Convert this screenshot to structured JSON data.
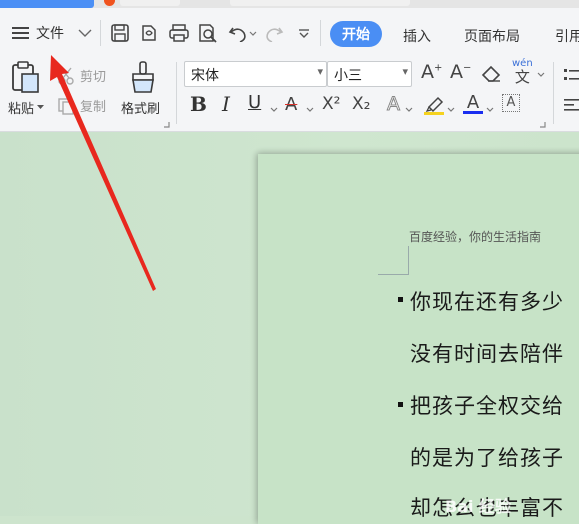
{
  "menu": {
    "file_label": "文件",
    "tabs": [
      "开始",
      "插入",
      "页面布局",
      "引用"
    ]
  },
  "clipboard": {
    "paste_label": "粘贴",
    "cut_label": "剪切",
    "copy_label": "复制",
    "format_painter_label": "格式刷"
  },
  "font": {
    "name": "宋体",
    "size": "小三"
  },
  "format_buttons": {
    "bold": "B",
    "italic": "I",
    "underline": "U",
    "strike": "A",
    "superscript": "X²",
    "subscript": "X₂",
    "text_effect": "A",
    "font_color": "A",
    "char_shading": "A",
    "pinyin": "wén"
  },
  "document": {
    "header_text": "百度经验，你的生活指南",
    "lines": [
      "你现在还有多少",
      "没有时间去陪伴",
      "把孩子全权交给",
      "的是为了给孩子",
      "却怎么也丰富不"
    ]
  },
  "watermark": "Bai 经验",
  "colors": {
    "accent": "#4a8ef4",
    "annotation_arrow": "#e8281e",
    "highlight_bar": "#f5d21f",
    "font_color_bar": "#1a2ef0"
  }
}
